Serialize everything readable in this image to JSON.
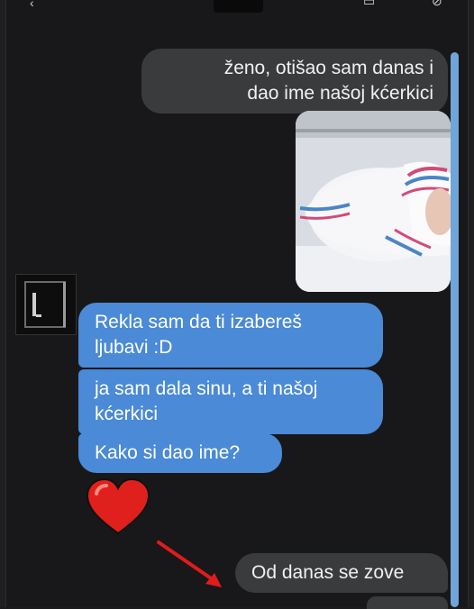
{
  "messages": {
    "sent_1": "ženo, otišao sam danas i dao ime našoj kćerkici",
    "sent_1_line1": "ženo, otišao sam danas i",
    "sent_1_line2": "dao ime našoj kćerkici",
    "received_1_line1": "Rekla sam da ti izabereš",
    "received_1_line2": "ljubavi :D",
    "received_2_line1": "ja sam dala sinu, a ti našoj",
    "received_2_line2": "kćerkici",
    "received_3": "Kako si dao ime?",
    "sent_2": "Od danas se zove"
  },
  "reaction": {
    "icon": "heart-emoji",
    "color": "#e0201c"
  },
  "annotation": {
    "icon": "red-arrow",
    "color": "#e01c1c"
  },
  "photo": {
    "icon": "newborn-baby-photo"
  },
  "colors": {
    "sent_bubble": "#3a3b3d",
    "received_bubble": "#4a8ad6",
    "scrollbar": "#6fa5d9"
  }
}
